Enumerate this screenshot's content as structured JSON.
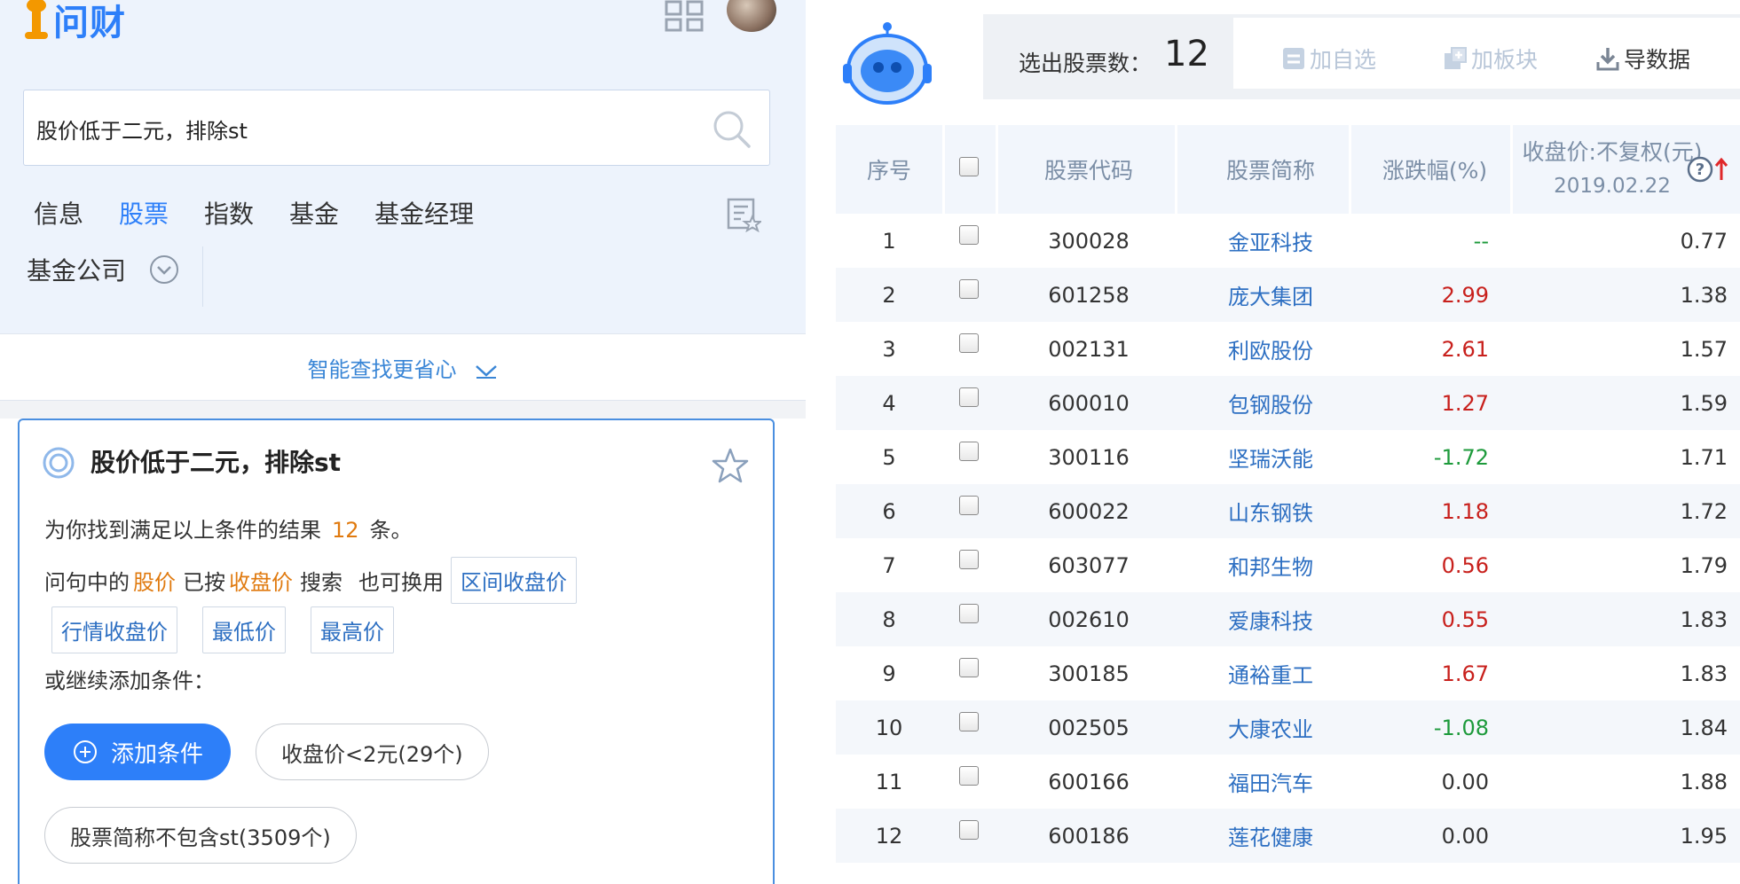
{
  "app": {
    "logo_text": "问财",
    "search": {
      "value": "股价低于二元，排除st"
    },
    "tabs": [
      {
        "label": "信息",
        "active": false
      },
      {
        "label": "股票",
        "active": true
      },
      {
        "label": "指数",
        "active": false
      },
      {
        "label": "基金",
        "active": false
      },
      {
        "label": "基金经理",
        "active": false
      }
    ],
    "tabs_row2": [
      {
        "label": "基金公司"
      }
    ],
    "smart_find": "智能查找更省心"
  },
  "card": {
    "title": "股价低于二元，排除st",
    "result_prefix": "为你找到满足以上条件的结果",
    "result_count": "12",
    "result_suffix": "条。",
    "alt_part1": "问句中的",
    "alt_term": "股价",
    "alt_part2": "已按",
    "alt_used": "收盘价",
    "alt_part3": "搜索",
    "alt_part4": "也可换用",
    "alt_chips": [
      "区间收盘价",
      "行情收盘价",
      "最低价",
      "最高价"
    ],
    "add_more": "或继续添加条件：",
    "add_button": "添加条件",
    "conditions": [
      "收盘价<2元(29个)",
      "股票简称不包含st(3509个)"
    ]
  },
  "results": {
    "count_label": "选出股票数：",
    "count_value": "12",
    "toolbar": {
      "add_watch": "加自选",
      "add_block": "加板块",
      "export": "导数据"
    },
    "columns": {
      "index": "序号",
      "code": "股票代码",
      "name": "股票简称",
      "change": "涨跌幅(%)",
      "close": "收盘价:不复权(元)",
      "close_date": "2019.02.22"
    },
    "rows": [
      {
        "idx": "1",
        "code": "300028",
        "name": "金亚科技",
        "change": "--",
        "dir": "flat",
        "close": "0.77"
      },
      {
        "idx": "2",
        "code": "601258",
        "name": "庞大集团",
        "change": "2.99",
        "dir": "up",
        "close": "1.38"
      },
      {
        "idx": "3",
        "code": "002131",
        "name": "利欧股份",
        "change": "2.61",
        "dir": "up",
        "close": "1.57"
      },
      {
        "idx": "4",
        "code": "600010",
        "name": "包钢股份",
        "change": "1.27",
        "dir": "up",
        "close": "1.59"
      },
      {
        "idx": "5",
        "code": "300116",
        "name": "坚瑞沃能",
        "change": "-1.72",
        "dir": "down",
        "close": "1.71"
      },
      {
        "idx": "6",
        "code": "600022",
        "name": "山东钢铁",
        "change": "1.18",
        "dir": "up",
        "close": "1.72"
      },
      {
        "idx": "7",
        "code": "603077",
        "name": "和邦生物",
        "change": "0.56",
        "dir": "up",
        "close": "1.79"
      },
      {
        "idx": "8",
        "code": "002610",
        "name": "爱康科技",
        "change": "0.55",
        "dir": "up",
        "close": "1.83"
      },
      {
        "idx": "9",
        "code": "300185",
        "name": "通裕重工",
        "change": "1.67",
        "dir": "up",
        "close": "1.83"
      },
      {
        "idx": "10",
        "code": "002505",
        "name": "大康农业",
        "change": "-1.08",
        "dir": "down",
        "close": "1.84"
      },
      {
        "idx": "11",
        "code": "600166",
        "name": "福田汽车",
        "change": "0.00",
        "dir": "zero",
        "close": "1.88"
      },
      {
        "idx": "12",
        "code": "600186",
        "name": "莲花健康",
        "change": "0.00",
        "dir": "zero",
        "close": "1.95"
      }
    ]
  },
  "colors": {
    "accent": "#2d7ff9",
    "orange": "#e07a0f",
    "up": "#c8201c",
    "down": "#1d9a3b",
    "link": "#2d6fc2"
  },
  "icons": [
    "logo-icon",
    "grid-icon",
    "search-icon",
    "list-star-icon",
    "chevron-down-circle-icon",
    "chevron-down-icon",
    "target-ring-icon",
    "star-icon",
    "plus-circle-icon",
    "robot-icon",
    "add-watch-icon",
    "add-block-icon",
    "download-icon",
    "help-icon",
    "sort-up-icon"
  ]
}
